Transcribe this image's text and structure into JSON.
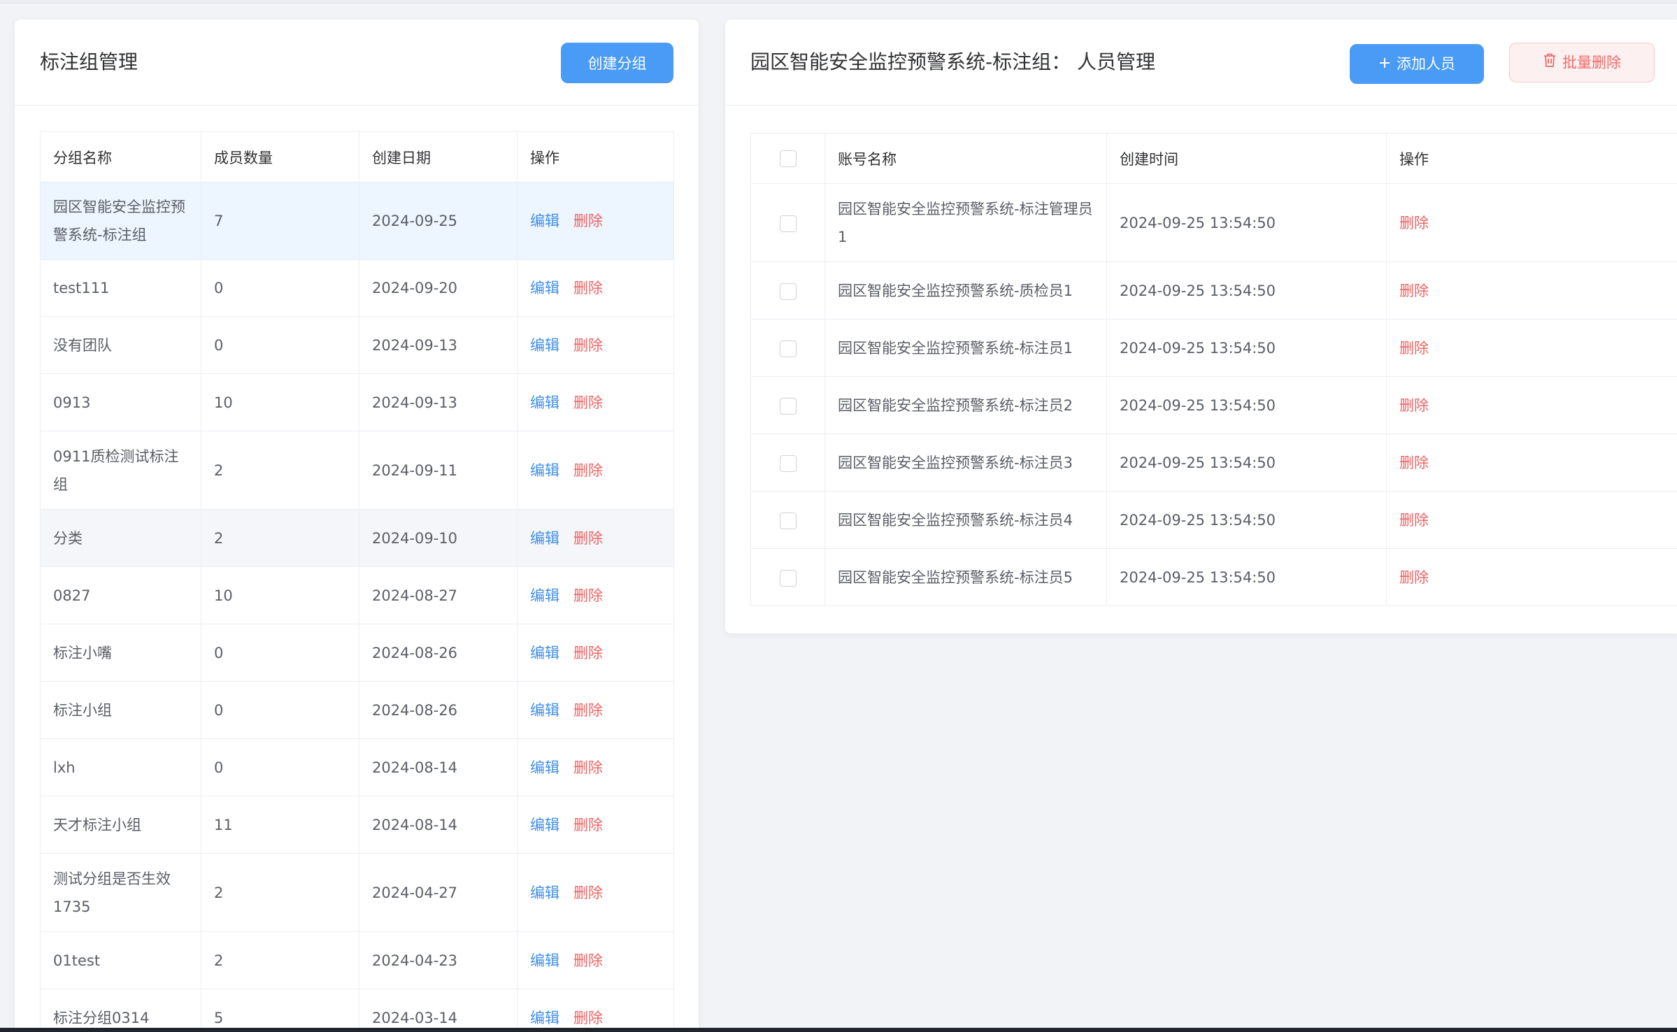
{
  "left_panel": {
    "title": "标注组管理",
    "create_button": "创建分组",
    "columns": [
      "分组名称",
      "成员数量",
      "创建日期",
      "操作"
    ],
    "edit_label": "编辑",
    "delete_label": "删除",
    "rows": [
      {
        "name": "园区智能安全监控预警系统-标注组",
        "count": "7",
        "date": "2024-09-25"
      },
      {
        "name": "test111",
        "count": "0",
        "date": "2024-09-20"
      },
      {
        "name": "没有团队",
        "count": "0",
        "date": "2024-09-13"
      },
      {
        "name": "0913",
        "count": "10",
        "date": "2024-09-13"
      },
      {
        "name": "0911质检测试标注组",
        "count": "2",
        "date": "2024-09-11"
      },
      {
        "name": "分类",
        "count": "2",
        "date": "2024-09-10"
      },
      {
        "name": "0827",
        "count": "10",
        "date": "2024-08-27"
      },
      {
        "name": "标注小嘴",
        "count": "0",
        "date": "2024-08-26"
      },
      {
        "name": "标注小组",
        "count": "0",
        "date": "2024-08-26"
      },
      {
        "name": "lxh",
        "count": "0",
        "date": "2024-08-14"
      },
      {
        "name": "天才标注小组",
        "count": "11",
        "date": "2024-08-14"
      },
      {
        "name": "测试分组是否生效1735",
        "count": "2",
        "date": "2024-04-27"
      },
      {
        "name": "01test",
        "count": "2",
        "date": "2024-04-23"
      },
      {
        "name": "标注分组0314",
        "count": "5",
        "date": "2024-03-14"
      }
    ]
  },
  "right_panel": {
    "title": "园区智能安全监控预警系统-标注组：  人员管理",
    "add_button": "添加人员",
    "batch_delete_button": "批量删除",
    "columns": [
      "账号名称",
      "创建时间",
      "操作"
    ],
    "delete_label": "删除",
    "rows": [
      {
        "account": "园区智能安全监控预警系统-标注管理员1",
        "created": "2024-09-25 13:54:50"
      },
      {
        "account": "园区智能安全监控预警系统-质检员1",
        "created": "2024-09-25 13:54:50"
      },
      {
        "account": "园区智能安全监控预警系统-标注员1",
        "created": "2024-09-25 13:54:50"
      },
      {
        "account": "园区智能安全监控预警系统-标注员2",
        "created": "2024-09-25 13:54:50"
      },
      {
        "account": "园区智能安全监控预警系统-标注员3",
        "created": "2024-09-25 13:54:50"
      },
      {
        "account": "园区智能安全监控预警系统-标注员4",
        "created": "2024-09-25 13:54:50"
      },
      {
        "account": "园区智能安全监控预警系统-标注员5",
        "created": "2024-09-25 13:54:50"
      }
    ]
  },
  "colors": {
    "primary": "#4a9bf5",
    "danger": "#ef6464",
    "selected_row": "#edf5fe"
  },
  "icons": {
    "add": "plus-icon",
    "batch_delete": "trash-icon"
  }
}
